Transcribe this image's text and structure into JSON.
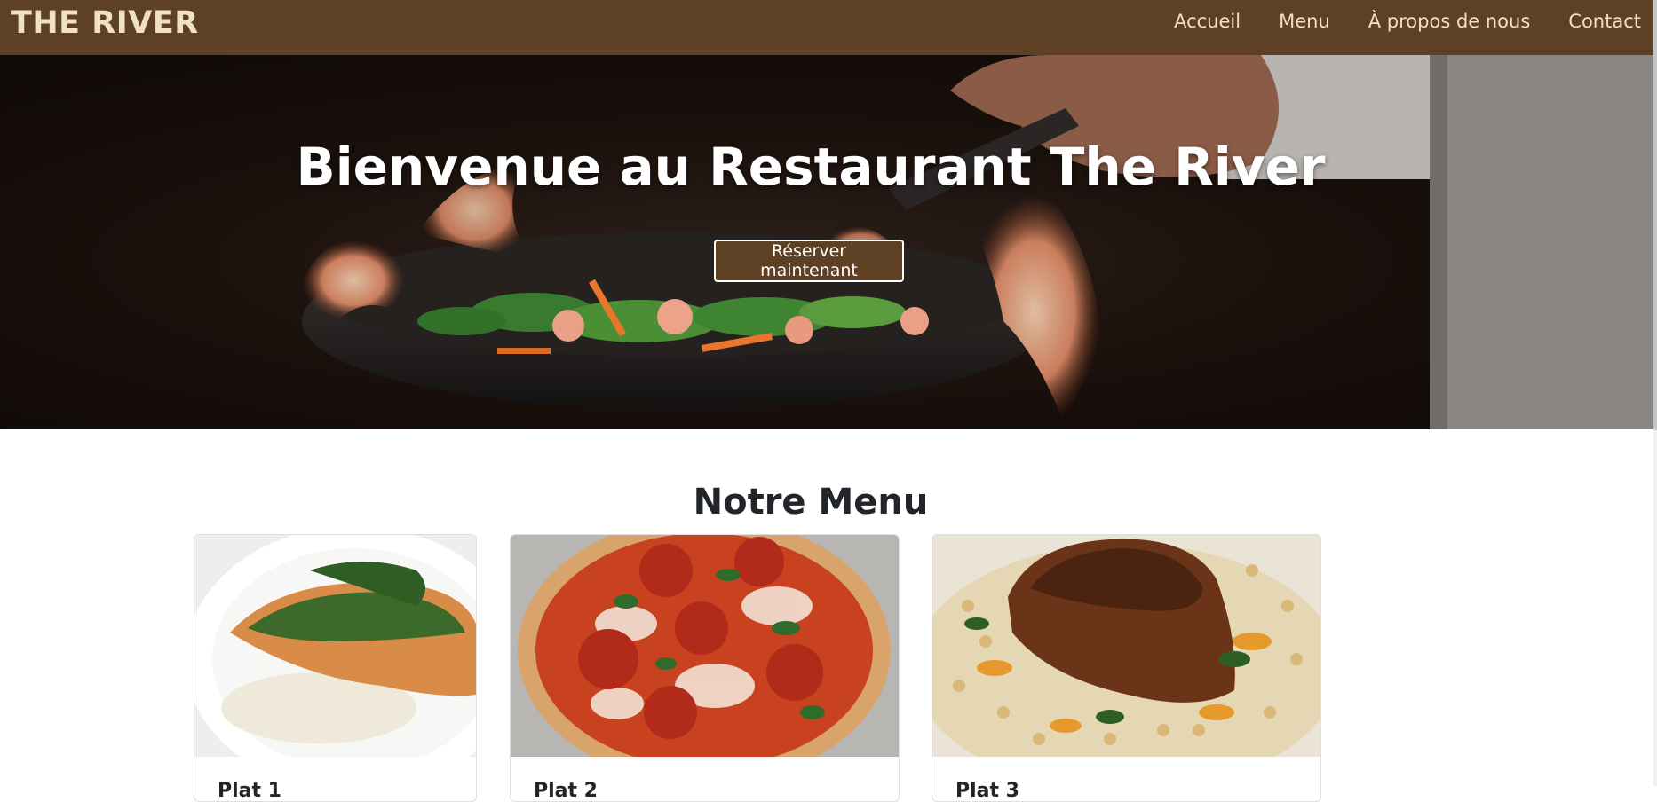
{
  "navbar": {
    "brand": "THE RIVER",
    "links": [
      {
        "label": "Accueil"
      },
      {
        "label": "Menu"
      },
      {
        "label": "À propos de nous"
      },
      {
        "label": "Contact"
      }
    ]
  },
  "hero": {
    "title": "Bienvenue au Restaurant The River",
    "cta_label": "Réserver maintenant"
  },
  "menu": {
    "title": "Notre Menu",
    "cards": [
      {
        "title": "Plat 1",
        "image": "fish-fillet-dish"
      },
      {
        "title": "Plat 2",
        "image": "pepperoni-pizza"
      },
      {
        "title": "Plat 3",
        "image": "steak-with-couscous"
      }
    ]
  },
  "colors": {
    "navbar_bg": "#5e4024",
    "navbar_text": "#f1dfc6",
    "cta_bg": "#5e4024",
    "heading_text": "#212529"
  }
}
